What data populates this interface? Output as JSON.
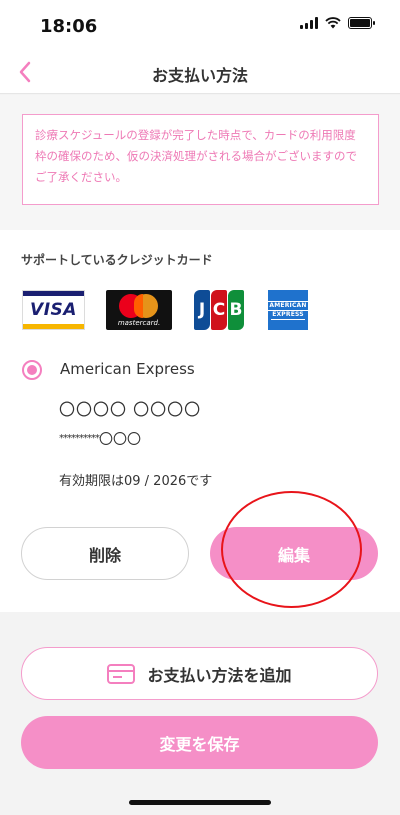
{
  "status_bar": {
    "time": "18:06"
  },
  "nav": {
    "back_icon": "chevron-left-icon",
    "title": "お支払い方法"
  },
  "notice": {
    "text": "診療スケジュールの登録が完了した時点で、カードの利用限度枠の確保のため、仮の決済処理がされる場合がございますのでご了承ください。"
  },
  "supported_cards": {
    "label": "サポートしているクレジットカード",
    "logos": [
      {
        "name": "visa-logo",
        "text": "VISA"
      },
      {
        "name": "mastercard-logo",
        "text": "mastercard."
      },
      {
        "name": "jcb-logo",
        "letters": [
          "J",
          "C",
          "B"
        ]
      },
      {
        "name": "amex-logo",
        "lines": [
          "AMERICAN",
          "EXPRESS"
        ]
      }
    ]
  },
  "selected_card": {
    "brand": "American Express",
    "holder": "〇〇〇〇 〇〇〇〇",
    "number_mask": "**********",
    "number_tail": "〇〇〇",
    "expiry": "有効期限は09 / 2026です"
  },
  "buttons": {
    "delete": "削除",
    "edit": "編集",
    "add_payment": "お支払い方法を追加",
    "save": "変更を保存"
  },
  "colors": {
    "accent": "#f58fc7",
    "accent_border": "#f49ccc",
    "notice_text": "#ee79b5",
    "annotation": "#e8141a"
  }
}
